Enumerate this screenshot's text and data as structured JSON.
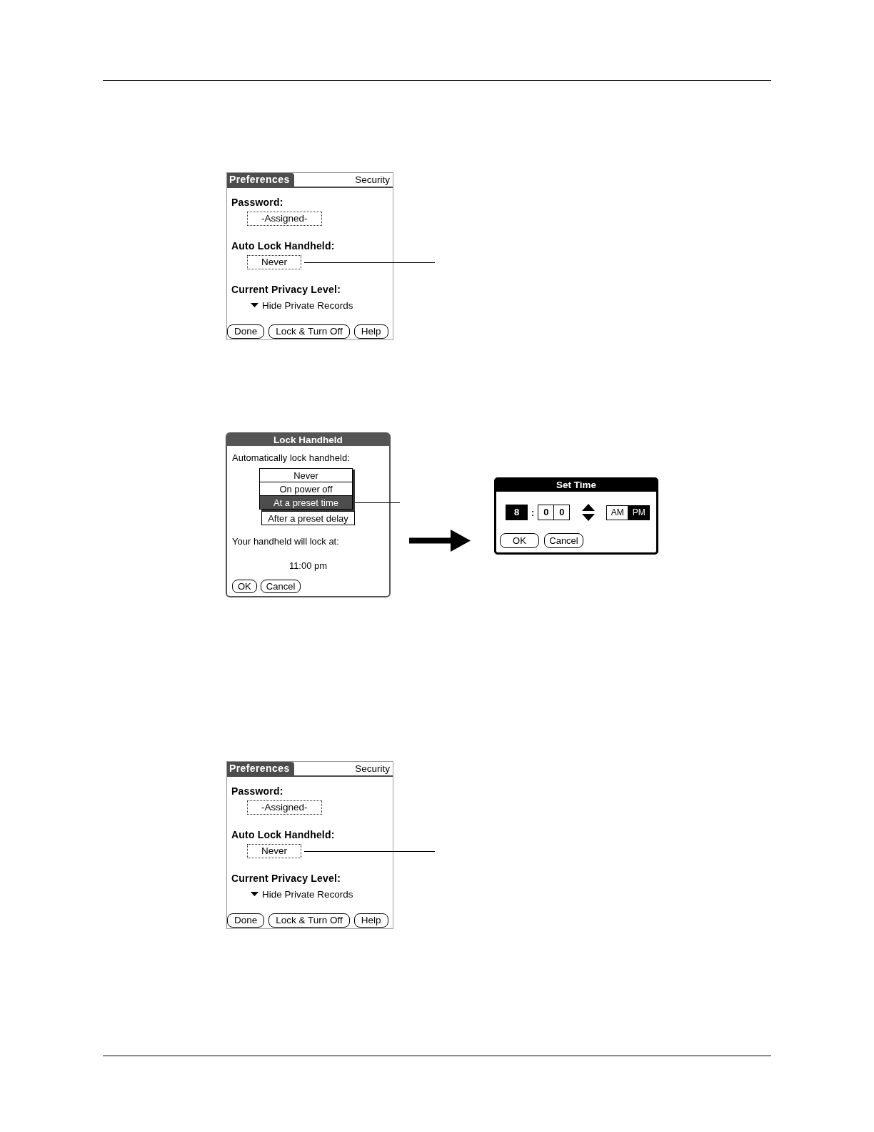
{
  "figures": [
    {
      "kind": "preferences",
      "title": "Preferences",
      "category": "Security",
      "selectors": [
        {
          "label": "Password:",
          "value": "-Assigned-",
          "callout": false
        },
        {
          "label": "Auto Lock Handheld:",
          "value": "Never",
          "callout": true
        }
      ],
      "privacy": {
        "label": "Current Privacy Level:",
        "value": "Hide Private Records"
      },
      "buttons": [
        "Done",
        "Lock & Turn Off",
        "Help"
      ]
    },
    {
      "kind": "lock_flow",
      "dialog": {
        "title": "Lock Handheld",
        "prompt": "Automatically lock handheld:",
        "options": [
          {
            "label": "Never",
            "selected": false,
            "callout": false
          },
          {
            "label": "On power off",
            "selected": false,
            "callout": false
          },
          {
            "label": "At a preset time",
            "selected": true,
            "callout": true
          },
          {
            "label": "After a preset delay",
            "selected": false,
            "callout": false
          }
        ],
        "lock_at_label": "Your handheld will lock at:",
        "lock_time": "11:00 pm",
        "buttons": [
          "OK",
          "Cancel"
        ]
      },
      "set_time": {
        "title": "Set Time",
        "hour": {
          "value": "8",
          "selected": true
        },
        "separator": ":",
        "minutes": [
          {
            "value": "0",
            "selected": false
          },
          {
            "value": "0",
            "selected": false
          }
        ],
        "periods": [
          {
            "label": "AM",
            "selected": false
          },
          {
            "label": "PM",
            "selected": true
          }
        ],
        "buttons": [
          "OK",
          "Cancel"
        ]
      }
    },
    {
      "kind": "preferences",
      "title": "Preferences",
      "category": "Security",
      "selectors": [
        {
          "label": "Password:",
          "value": "-Assigned-",
          "callout": false
        },
        {
          "label": "Auto Lock Handheld:",
          "value": "Never",
          "callout": true
        }
      ],
      "privacy": {
        "label": "Current Privacy Level:",
        "value": "Hide Private Records"
      },
      "buttons": [
        "Done",
        "Lock & Turn Off",
        "Help"
      ]
    }
  ]
}
